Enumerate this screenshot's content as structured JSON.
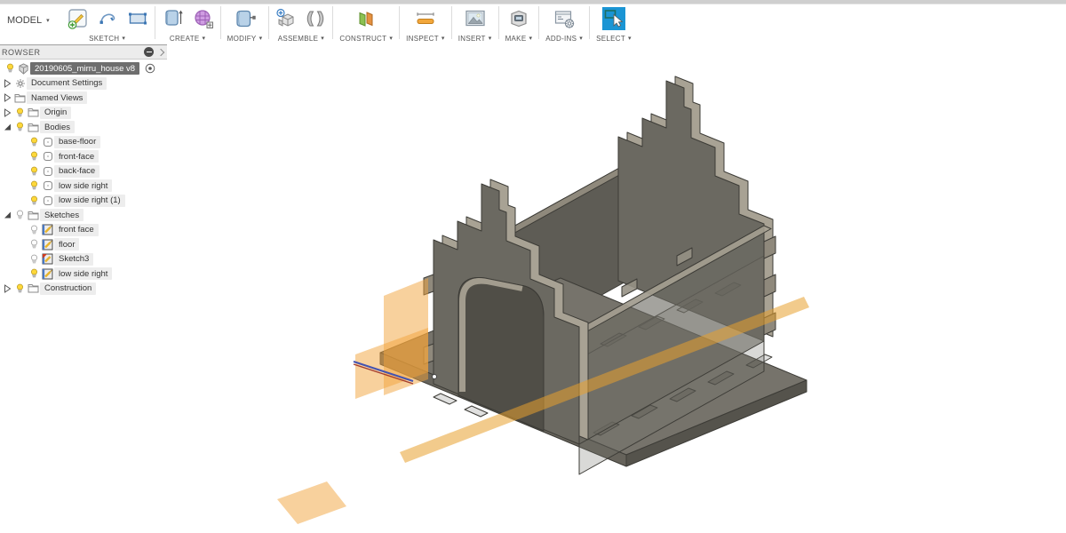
{
  "ui": {
    "caret": "▾"
  },
  "toolbar": {
    "model_menu": "MODEL",
    "groups": [
      {
        "label": "SKETCH",
        "icons": [
          "create-sketch-icon",
          "spline-icon",
          "rectangle-icon"
        ]
      },
      {
        "label": "CREATE",
        "icons": [
          "extrude-icon",
          "form-icon"
        ]
      },
      {
        "label": "MODIFY",
        "icons": [
          "press-pull-icon"
        ]
      },
      {
        "label": "ASSEMBLE",
        "icons": [
          "new-component-icon",
          "joint-icon"
        ]
      },
      {
        "label": "CONSTRUCT",
        "icons": [
          "construction-plane-icon"
        ]
      },
      {
        "label": "INSPECT",
        "icons": [
          "measure-icon"
        ]
      },
      {
        "label": "INSERT",
        "icons": [
          "insert-image-icon"
        ]
      },
      {
        "label": "MAKE",
        "icons": [
          "3d-print-icon"
        ]
      },
      {
        "label": "ADD-INS",
        "icons": [
          "scripts-addins-icon"
        ]
      },
      {
        "label": "SELECT",
        "icons": [
          "select-icon"
        ]
      }
    ]
  },
  "browser": {
    "header": "ROWSER",
    "items": [
      {
        "label": "20190605_mirru_house v8",
        "level": 0,
        "bulb": "on",
        "icon": "component",
        "selected": true,
        "trailing": "radio"
      },
      {
        "label": "Document Settings",
        "level": 0,
        "expander": "collapsed",
        "icon": "gear"
      },
      {
        "label": "Named Views",
        "level": 0,
        "expander": "collapsed",
        "icon": "folder"
      },
      {
        "label": "Origin",
        "level": 0,
        "expander": "collapsed",
        "bulb": "on",
        "icon": "folder"
      },
      {
        "label": "Bodies",
        "level": 0,
        "expander": "expanded",
        "bulb": "on",
        "icon": "folder"
      },
      {
        "label": "base-floor",
        "level": 1,
        "bulb": "on",
        "icon": "body"
      },
      {
        "label": "front-face",
        "level": 1,
        "bulb": "on",
        "icon": "body"
      },
      {
        "label": "back-face",
        "level": 1,
        "bulb": "on",
        "icon": "body"
      },
      {
        "label": "low side right",
        "level": 1,
        "bulb": "on",
        "icon": "body"
      },
      {
        "label": "low side right (1)",
        "level": 1,
        "bulb": "on",
        "icon": "body"
      },
      {
        "label": "Sketches",
        "level": 0,
        "expander": "expanded",
        "bulb": "off",
        "icon": "folder"
      },
      {
        "label": "front face",
        "level": 1,
        "bulb": "off",
        "icon": "sketch"
      },
      {
        "label": "floor",
        "level": 1,
        "bulb": "off",
        "icon": "sketch"
      },
      {
        "label": "Sketch3",
        "level": 1,
        "bulb": "off",
        "icon": "sketch-warn"
      },
      {
        "label": "low side right",
        "level": 1,
        "bulb": "on",
        "icon": "sketch"
      },
      {
        "label": "Construction",
        "level": 0,
        "expander": "collapsed",
        "bulb": "on",
        "icon": "folder"
      }
    ]
  },
  "viewport": {
    "colors": {
      "model_face": "#6b6961",
      "model_edge_light": "#a8a294",
      "model_outline": "#3d3c37",
      "construction_plane_orange": "#f2a33c",
      "sketch_line_blue": "#4553b0",
      "select_accent_blue": "#1b95d4",
      "bulb_yellow": "#ffd83a"
    }
  }
}
